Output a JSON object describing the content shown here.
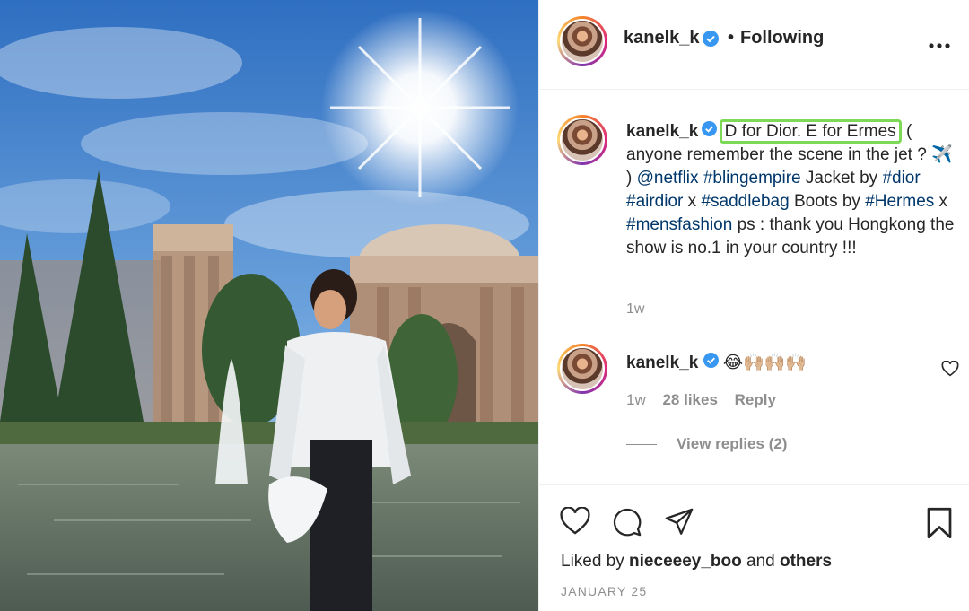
{
  "post": {
    "username": "kanelk_k",
    "follow_status": "Following",
    "separator": "•"
  },
  "caption": {
    "username": "kanelk_k",
    "highlight": "D for Dior. E for Ermes",
    "part1": " ( anyone remember the scene in the jet ? ✈️ ) ",
    "mention_netflix": "@netflix",
    "tag_blingempire": "#blingempire",
    "part2": " Jacket by ",
    "tag_dior": "#dior",
    "tag_airdior": "#airdior",
    "x1": " x ",
    "tag_saddlebag": "#saddlebag",
    "part3": " Boots by ",
    "tag_hermes": "#Hermes",
    "x2": " x ",
    "tag_mensfashion": "#mensfashion",
    "part4": " ps : thank you Hongkong the show is no.1 in your country !!!",
    "time": "1w"
  },
  "comment": {
    "username": "kanelk_k",
    "text": "😂🙌🏼🙌🏼🙌🏼",
    "time": "1w",
    "likes": "28 likes",
    "reply": "Reply",
    "view_replies": "View replies (2)"
  },
  "footer": {
    "liked_by_prefix": "Liked by ",
    "liked_by_user": "nieceeey_boo",
    "liked_by_mid": " and ",
    "liked_by_others": "others",
    "date": "JANUARY 25"
  },
  "colors": {
    "highlight_border": "#7ed957",
    "verified": "#3897f0",
    "link": "#00376b",
    "muted": "#8e8e8e"
  },
  "icons": [
    "more-icon",
    "verified-icon",
    "heart-icon",
    "comment-icon",
    "share-icon",
    "bookmark-icon"
  ]
}
